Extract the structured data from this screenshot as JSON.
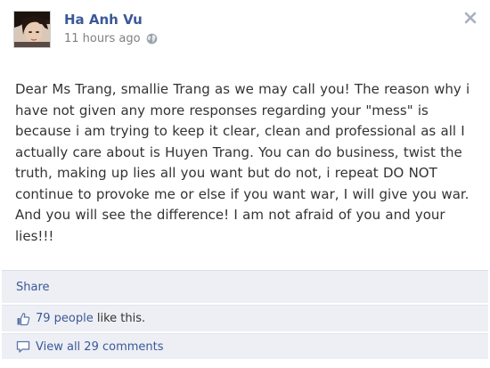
{
  "post": {
    "author": "Ha Anh Vu",
    "timestamp": "11 hours ago",
    "privacy_icon": "globe-icon",
    "close_icon": "close-icon",
    "message": "Dear Ms Trang, smallie Trang as we may call you! The reason why i have not given any more responses regarding your \"mess\" is because i am trying to keep it clear, clean and professional as all I actually care about is Huyen Trang. You can do business, twist the truth, making up lies all you want but do not, i repeat DO NOT continue to provoke me or else if you want war, I will give you war. And you will see the difference! I am not afraid of you and your lies!!!"
  },
  "actions": {
    "share_label": "Share",
    "likes_link": "79 people",
    "likes_suffix": " like this.",
    "likes_icon": "thumbs-up-icon",
    "comments_link": "View all 29 comments",
    "comments_icon": "comment-icon"
  },
  "colors": {
    "link": "#3b5998",
    "action_bar_bg": "#edeff4",
    "text": "#333333",
    "meta": "#808080"
  }
}
